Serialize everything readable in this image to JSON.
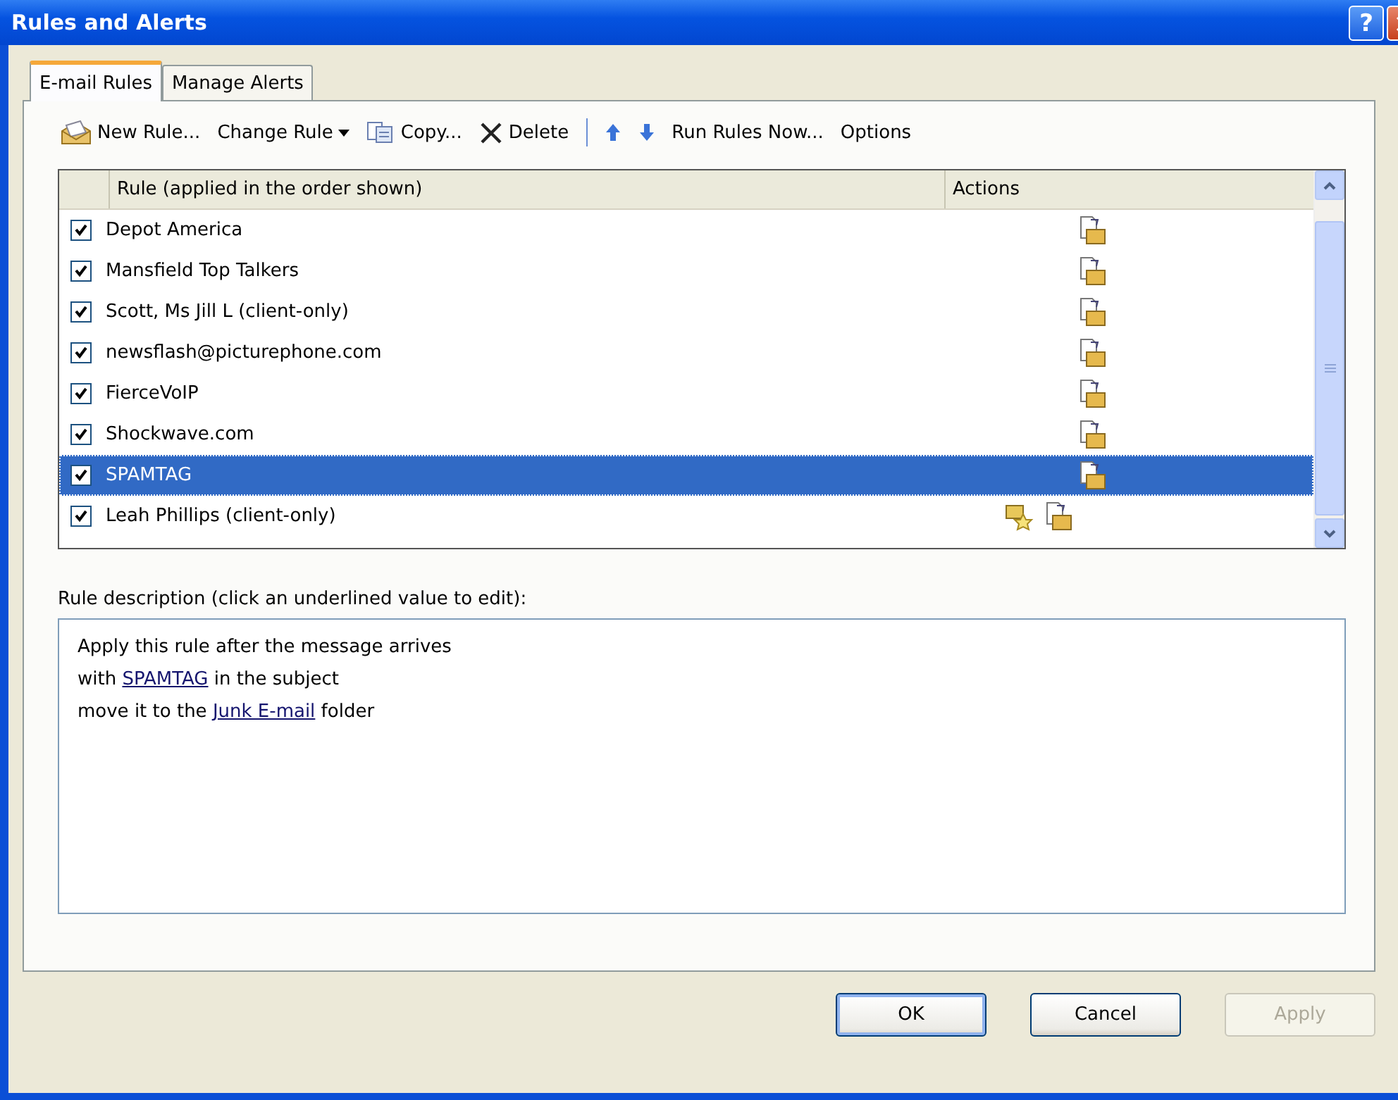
{
  "window": {
    "title": "Rules and Alerts"
  },
  "title_buttons": [
    {
      "kind": "help",
      "label": "?"
    },
    {
      "kind": "close"
    }
  ],
  "tabs": [
    {
      "label": "E-mail Rules",
      "selected": true
    },
    {
      "label": "Manage Alerts",
      "selected": false
    }
  ],
  "toolbar": [
    {
      "kind": "new",
      "label": "New Rule..."
    },
    {
      "kind": "dropdown",
      "label": "Change Rule"
    },
    {
      "kind": "copy",
      "label": "Copy..."
    },
    {
      "kind": "delete",
      "label": "Delete"
    },
    {
      "kind": "separator"
    },
    {
      "kind": "up"
    },
    {
      "kind": "down"
    },
    {
      "kind": "plain",
      "label": "Run Rules Now..."
    },
    {
      "kind": "plain",
      "label": "Options"
    }
  ],
  "rules_list": {
    "columns": [
      "Rule (applied in the order shown)",
      "Actions"
    ],
    "rows": [
      {
        "name": "Depot America",
        "checked": true,
        "selected": false,
        "alert_icon": false
      },
      {
        "name": "Mansfield Top Talkers",
        "checked": true,
        "selected": false,
        "alert_icon": false
      },
      {
        "name": "Scott, Ms Jill L  (client-only)",
        "checked": true,
        "selected": false,
        "alert_icon": false
      },
      {
        "name": "newsflash@picturephone.com",
        "checked": true,
        "selected": false,
        "alert_icon": false
      },
      {
        "name": "FierceVoIP",
        "checked": true,
        "selected": false,
        "alert_icon": false
      },
      {
        "name": "Shockwave.com",
        "checked": true,
        "selected": false,
        "alert_icon": false
      },
      {
        "name": "SPAMTAG",
        "checked": true,
        "selected": true,
        "alert_icon": false
      },
      {
        "name": "Leah Phillips  (client-only)",
        "checked": true,
        "selected": false,
        "alert_icon": true
      }
    ]
  },
  "description": {
    "label": "Rule description (click an underlined value to edit):",
    "lines": [
      [
        {
          "kind": "text",
          "text": "Apply this rule after the message arrives"
        }
      ],
      [
        {
          "kind": "text",
          "text": "with "
        },
        {
          "kind": "link",
          "text": "SPAMTAG"
        },
        {
          "kind": "text",
          "text": " in the subject"
        }
      ],
      [
        {
          "kind": "text",
          "text": "move it to the "
        },
        {
          "kind": "link",
          "text": "Junk E-mail"
        },
        {
          "kind": "text",
          "text": " folder"
        }
      ]
    ]
  },
  "buttons": [
    {
      "label": "OK",
      "kind": "default",
      "disabled": false
    },
    {
      "label": "Cancel",
      "kind": "normal",
      "disabled": false
    },
    {
      "label": "Apply",
      "kind": "normal",
      "disabled": true
    }
  ]
}
